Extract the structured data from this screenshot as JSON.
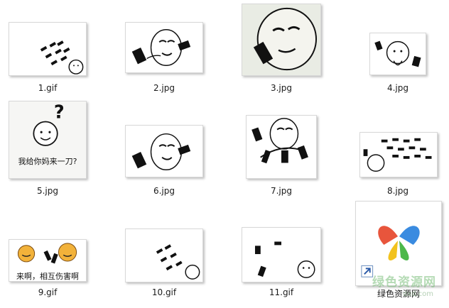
{
  "files": [
    {
      "name": "1.gif"
    },
    {
      "name": "2.jpg"
    },
    {
      "name": "3.jpg"
    },
    {
      "name": "4.jpg"
    },
    {
      "name": "5.jpg",
      "caption": "我给你妈来一刀?"
    },
    {
      "name": "6.jpg"
    },
    {
      "name": "7.jpg"
    },
    {
      "name": "8.jpg"
    },
    {
      "name": "9.gif",
      "caption": "来啊，相互伤害啊"
    },
    {
      "name": "10.gif"
    },
    {
      "name": "11.gif"
    },
    {
      "name": "绿色资源网"
    }
  ],
  "watermark": {
    "text": "绿色资源网",
    "sub": "dxd.com"
  }
}
